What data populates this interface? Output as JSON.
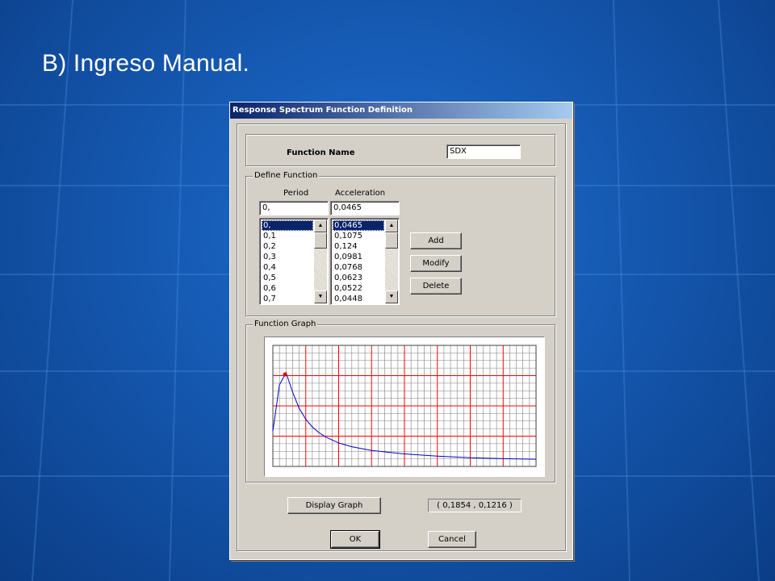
{
  "slide": {
    "title": "B) Ingreso Manual."
  },
  "dialog": {
    "title": "Response Spectrum  Function Definition",
    "function_name_label": "Function Name",
    "function_name_value": "SDX",
    "define_function_legend": "Define Function",
    "period_header": "Period",
    "acceleration_header": "Acceleration",
    "period_input": "0,",
    "acceleration_input": "0,0465",
    "period_list": [
      "0,",
      "0,1",
      "0,2",
      "0,3",
      "0,4",
      "0,5",
      "0,6",
      "0,7"
    ],
    "acceleration_list": [
      "0,0465",
      "0,1075",
      "0,124",
      "0,0981",
      "0,0768",
      "0,0623",
      "0,0522",
      "0,0448"
    ],
    "add_label": "Add",
    "modify_label": "Modify",
    "delete_label": "Delete",
    "function_graph_legend": "Function Graph",
    "display_graph_label": "Display Graph",
    "coordinate_readout": "( 0,1854  ,  0,1216 )",
    "ok_label": "OK",
    "cancel_label": "Cancel"
  },
  "chart_data": {
    "type": "line",
    "x": [
      0,
      0.1,
      0.1854,
      0.2,
      0.3,
      0.4,
      0.5,
      0.6,
      0.7,
      0.8,
      1.0,
      1.2,
      1.5,
      2.0,
      2.5,
      3.0,
      3.5,
      4.0
    ],
    "y": [
      0.0465,
      0.1075,
      0.1216,
      0.124,
      0.0981,
      0.0768,
      0.0623,
      0.0522,
      0.0448,
      0.039,
      0.031,
      0.026,
      0.021,
      0.0165,
      0.0135,
      0.0115,
      0.0102,
      0.0095
    ],
    "xlim": [
      0,
      4.0
    ],
    "ylim": [
      0,
      0.16
    ],
    "marker": {
      "x": 0.1854,
      "y": 0.1216
    },
    "grid": true,
    "colors": {
      "line": "#0000cc",
      "major_grid": "#ff0000",
      "minor_grid": "#808080",
      "marker": "#dd0000"
    }
  }
}
